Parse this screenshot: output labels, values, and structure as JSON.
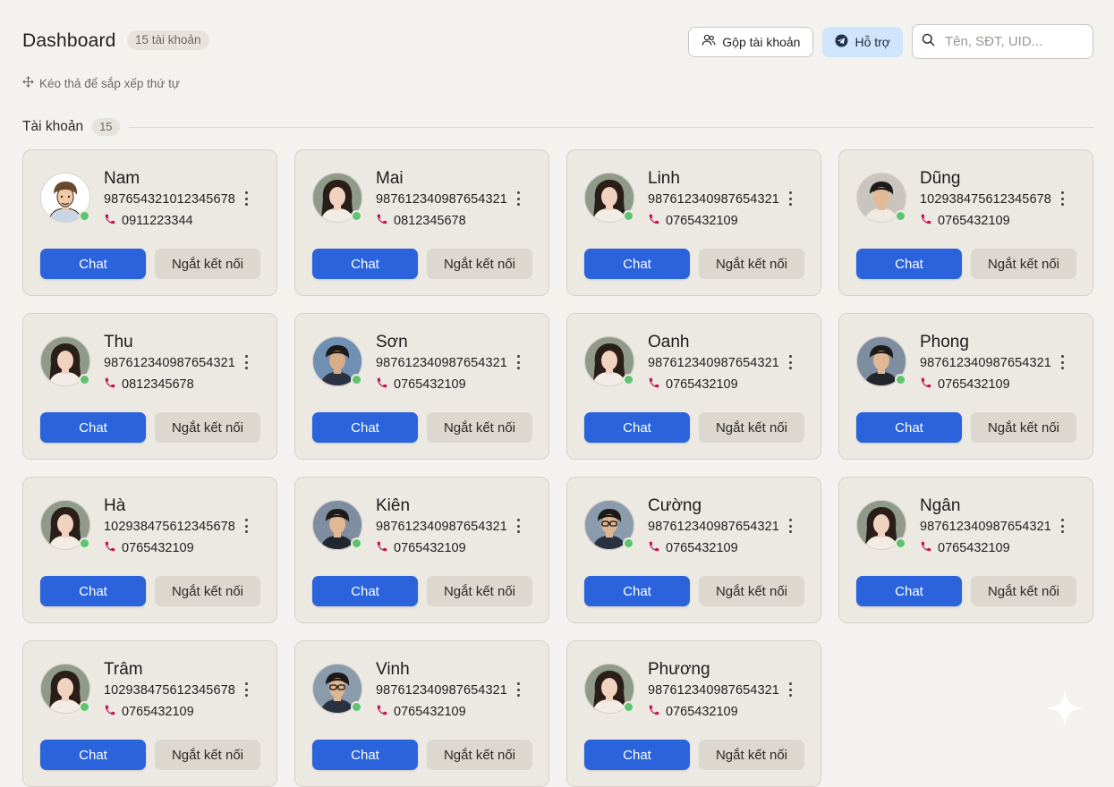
{
  "header": {
    "title": "Dashboard",
    "account_count": "15 tài khoản",
    "merge_label": "Gộp tài khoản",
    "support_label": "Hỗ trợ",
    "search_placeholder": "Tên, SĐT, UID..."
  },
  "hint": "Kéo thả để sắp xếp thứ tự",
  "section": {
    "label": "Tài khoản",
    "count": "15"
  },
  "labels": {
    "chat": "Chat",
    "disconnect": "Ngắt kết nối"
  },
  "colors": {
    "primary": "#2a63db",
    "online": "#5cc46e",
    "phone_icon": "#c2185b",
    "support_bg": "#cfe5fb"
  },
  "accounts": [
    {
      "name": "Nam",
      "uid": "987654321012345678",
      "phone": "0911223344",
      "avatar": "cartoon-man"
    },
    {
      "name": "Mai",
      "uid": "987612340987654321",
      "phone": "0812345678",
      "avatar": "woman-photo"
    },
    {
      "name": "Linh",
      "uid": "987612340987654321",
      "phone": "0765432109",
      "avatar": "woman-photo"
    },
    {
      "name": "Dũng",
      "uid": "102938475612345678",
      "phone": "0765432109",
      "avatar": "man-photo"
    },
    {
      "name": "Thu",
      "uid": "987612340987654321",
      "phone": "0812345678",
      "avatar": "woman-photo"
    },
    {
      "name": "Sơn",
      "uid": "987612340987654321",
      "phone": "0765432109",
      "avatar": "man-landscape-photo"
    },
    {
      "name": "Oanh",
      "uid": "987612340987654321",
      "phone": "0765432109",
      "avatar": "woman-photo"
    },
    {
      "name": "Phong",
      "uid": "987612340987654321",
      "phone": "0765432109",
      "avatar": "man-suit-photo"
    },
    {
      "name": "Hà",
      "uid": "102938475612345678",
      "phone": "0765432109",
      "avatar": "woman-photo"
    },
    {
      "name": "Kiên",
      "uid": "987612340987654321",
      "phone": "0765432109",
      "avatar": "man-suit-photo"
    },
    {
      "name": "Cường",
      "uid": "987612340987654321",
      "phone": "0765432109",
      "avatar": "man-glasses-photo"
    },
    {
      "name": "Ngân",
      "uid": "987612340987654321",
      "phone": "0765432109",
      "avatar": "woman-photo"
    },
    {
      "name": "Trâm",
      "uid": "102938475612345678",
      "phone": "0765432109",
      "avatar": "woman-photo"
    },
    {
      "name": "Vinh",
      "uid": "987612340987654321",
      "phone": "0765432109",
      "avatar": "man-glasses-photo"
    },
    {
      "name": "Phương",
      "uid": "987612340987654321",
      "phone": "0765432109",
      "avatar": "woman-photo"
    }
  ]
}
